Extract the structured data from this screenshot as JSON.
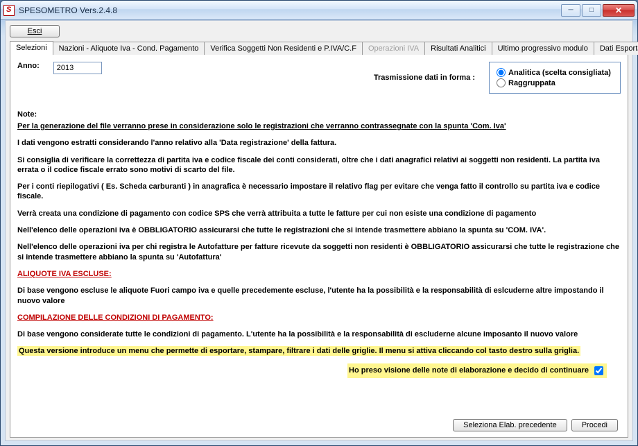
{
  "window": {
    "title": "SPESOMETRO Vers.2.4.8"
  },
  "buttons": {
    "esci": "Esci",
    "seleziona_elab": "Seleziona Elab. precedente",
    "procedi": "Procedi"
  },
  "tabs": [
    {
      "label": "Selezioni",
      "active": true
    },
    {
      "label": "Nazioni - Aliquote Iva - Cond. Pagamento"
    },
    {
      "label": "Verifica Soggetti Non Residenti e P.IVA/C.F"
    },
    {
      "label": "Operazioni IVA",
      "disabled": true
    },
    {
      "label": "Risultati Analitici"
    },
    {
      "label": "Ultimo progressivo modulo"
    },
    {
      "label": "Dati Esportaz"
    }
  ],
  "form": {
    "anno_label": "Anno:",
    "anno_value": "2013",
    "trasm_label": "Trasmissione dati in forma :",
    "opt_analitica": "Analitica (scelta consigliata)",
    "opt_raggruppata": "Raggruppata"
  },
  "notes": {
    "head": "Note:",
    "p1": "Per la generazione del file verranno prese in considerazione solo le registrazioni che verranno contrassegnate con la spunta 'Com. Iva'",
    "p2": "I dati vengono estratti considerando l'anno relativo alla 'Data registrazione' della fattura.",
    "p3": "Si consiglia di verificare la correttezza di partita iva e codice fiscale dei conti considerati,  oltre che i dati anagrafici relativi ai soggetti non residenti. La partita iva errata o il codice fiscale errato sono motivi di scarto del file.",
    "p4": "Per i conti riepilogativi ( Es. Scheda carburanti ) in anagrafica è necessario impostare il relativo flag per evitare che venga fatto il controllo su partita iva e codice fiscale.",
    "p5": "Verrà creata una condizione di pagamento con codice SPS che verrà attribuita a tutte le fatture per cui non esiste una condizione di pagamento",
    "p6": "Nell'elenco delle operazioni iva è OBBLIGATORIO assicurarsi che tutte le registrazioni che si intende trasmettere abbiano la spunta su 'COM. IVA'.",
    "p7": "Nell'elenco delle operazioni iva per chi registra le Autofatture per fatture ricevute da soggetti non residenti è OBBLIGATORIO assicurarsi che tutte le registrazione che si intende trasmettere abbiano la spunta su 'Autofattura'",
    "h1": "ALIQUOTE IVA ESCLUSE:",
    "p8": "Di base vengono escluse le aliquote Fuori campo iva e quelle precedemente escluse, l'utente ha la possibilità e la responsabilità di eslcuderne altre impostando il nuovo valore",
    "h2": "COMPILAZIONE DELLE CONDIZIONI DI PAGAMENTO:",
    "p9": "Di base vengono considerate tutte le condizioni di pagamento. L'utente ha la possibilità e la responsabilità di escluderne alcune imposanto il nuovo valore",
    "hl1": "Questa versione introduce un menu che permette di esportare, stampare, filtrare i dati delle griglie. Il menu si attiva cliccando col tasto destro sulla griglia.",
    "ack": "Ho preso visione delle note di elaborazione e decido di continuare"
  }
}
